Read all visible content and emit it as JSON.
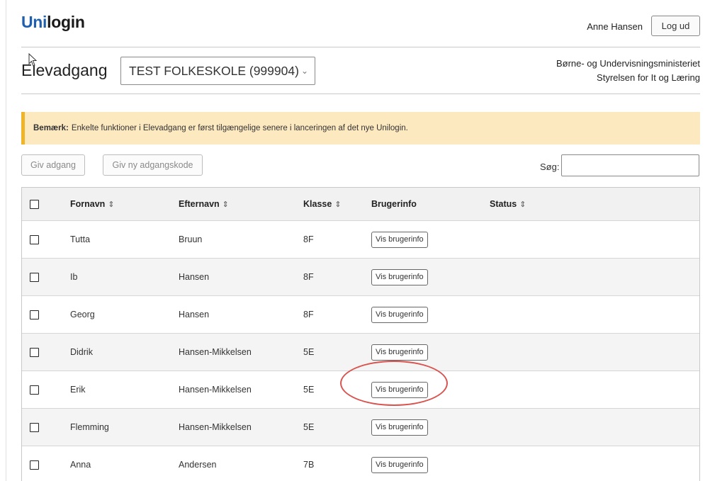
{
  "header": {
    "logo_part1": "Uni",
    "logo_part2": "login",
    "user_name": "Anne Hansen",
    "logout_label": "Log ud"
  },
  "app": {
    "title": "Elevadgang",
    "school_selected": "TEST FOLKESKOLE (999904)",
    "ministry_line1": "Børne- og Undervisningsministeriet",
    "ministry_line2": "Styrelsen for It og Læring"
  },
  "notice": {
    "label": "Bemærk:",
    "text": "Enkelte funktioner i Elevadgang er først tilgængelige senere i lanceringen af det nye Unilogin."
  },
  "toolbar": {
    "give_access_label": "Giv adgang",
    "new_password_label": "Giv ny adgangskode",
    "search_label": "Søg:",
    "search_value": ""
  },
  "table": {
    "columns": {
      "first_name": "Fornavn",
      "last_name": "Efternavn",
      "class": "Klasse",
      "user_info": "Brugerinfo",
      "status": "Status"
    },
    "button_label": "Vis brugerinfo",
    "rows": [
      {
        "first": "Tutta",
        "last": "Bruun",
        "class": "8F",
        "status": ""
      },
      {
        "first": "Ib",
        "last": "Hansen",
        "class": "8F",
        "status": ""
      },
      {
        "first": "Georg",
        "last": "Hansen",
        "class": "8F",
        "status": ""
      },
      {
        "first": "Didrik",
        "last": "Hansen-Mikkelsen",
        "class": "5E",
        "status": ""
      },
      {
        "first": "Erik",
        "last": "Hansen-Mikkelsen",
        "class": "5E",
        "status": ""
      },
      {
        "first": "Flemming",
        "last": "Hansen-Mikkelsen",
        "class": "5E",
        "status": ""
      },
      {
        "first": "Anna",
        "last": "Andersen",
        "class": "7B",
        "status": ""
      }
    ]
  },
  "colors": {
    "brand_blue": "#1f5fb0",
    "notice_bg": "#fde9c0",
    "notice_border": "#f0b429",
    "highlight": "#d9534f"
  }
}
